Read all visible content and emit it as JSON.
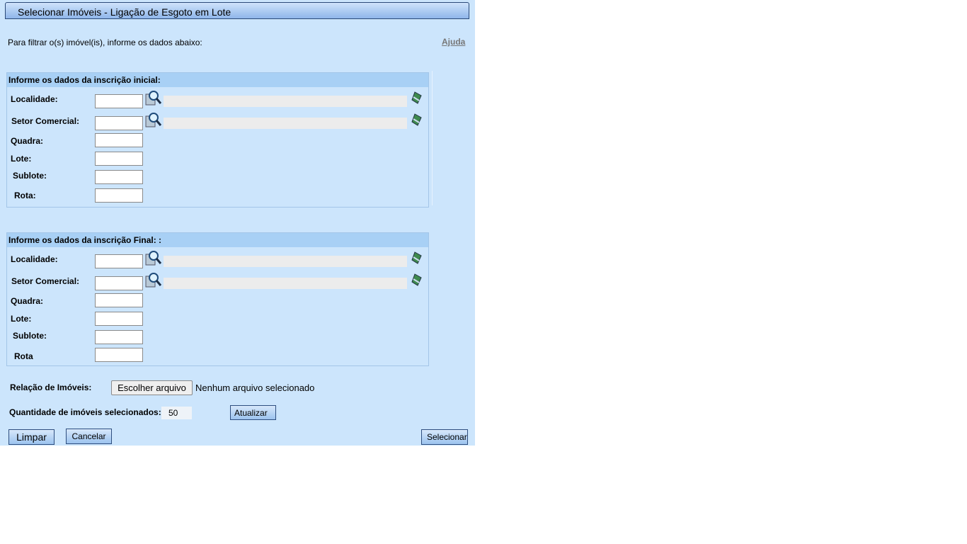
{
  "window": {
    "title": "Selecionar Imóveis - Ligação de Esgoto em Lote"
  },
  "instructions": "Para filtrar o(s) imóvel(is), informe os dados abaixo:",
  "help_link": "Ajuda",
  "initial": {
    "header": "Informe os dados da inscrição inicial:",
    "labels": {
      "localidade": "Localidade:",
      "setor": "Setor Comercial:",
      "quadra": "Quadra:",
      "lote": "Lote:",
      "sublote": "Sublote:",
      "rota": "Rota:"
    }
  },
  "final": {
    "header": "Informe os dados da inscrição Final: :",
    "labels": {
      "localidade": "Localidade:",
      "setor": "Setor Comercial:",
      "quadra": "Quadra:",
      "lote": "Lote:",
      "sublote": "Sublote:",
      "rota": "Rota"
    }
  },
  "file": {
    "label": "Relação de Imóveis:",
    "button": "Escolher arquivo",
    "status": "Nenhum arquivo selecionado"
  },
  "quantity": {
    "label": "Quantidade de imóveis selecionados:",
    "value": "50",
    "update_button": "Atualizar"
  },
  "buttons": {
    "clear": "Limpar",
    "cancel": "Cancelar",
    "select": "Selecionar"
  },
  "colors": {
    "panel": "#cce5fc",
    "section_header": "#a8d0f5",
    "title_bar": "#8fb6ea"
  }
}
